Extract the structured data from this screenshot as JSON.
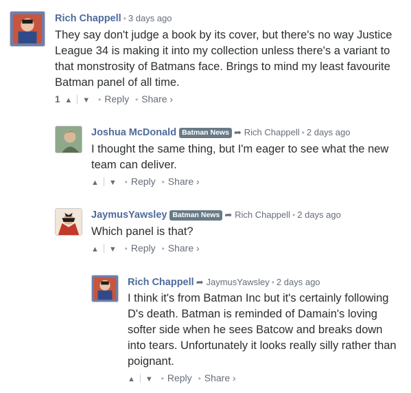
{
  "comments": [
    {
      "author": "Rich Chappell",
      "badge": "",
      "parent": "",
      "time": "3 days ago",
      "text": "They say don't judge a book by its cover, but there's no way Justice League 34 is making it into my collection unless there's a variant to that monstrosity of Batmans face. Brings to mind my least favourite Batman panel of all time.",
      "score": "1",
      "reply_label": "Reply",
      "share_label": "Share ›"
    },
    {
      "author": "Joshua McDonald",
      "badge": "Batman News",
      "parent": "Rich Chappell",
      "time": "2 days ago",
      "text": "I thought the same thing, but I'm eager to see what the new team can deliver.",
      "score": "",
      "reply_label": "Reply",
      "share_label": "Share ›"
    },
    {
      "author": "JaymusYawsley",
      "badge": "Batman News",
      "parent": "Rich Chappell",
      "time": "2 days ago",
      "text": "Which panel is that?",
      "score": "",
      "reply_label": "Reply",
      "share_label": "Share ›"
    },
    {
      "author": "Rich Chappell",
      "badge": "",
      "parent": "JaymusYawsley",
      "time": "2 days ago",
      "text": "I think it's from Batman Inc but it's certainly following D's death. Batman is reminded of Damain's loving softer side when he sees Batcow and breaks down into tears. Unfortunately it looks really silly rather than poignant.",
      "score": "",
      "reply_label": "Reply",
      "share_label": "Share ›"
    }
  ],
  "icons": {
    "upvote": "chevron-up-icon",
    "downvote": "chevron-down-icon",
    "reply_arrow": "reply-arrow-icon"
  },
  "colors": {
    "author": "#4e6b9c",
    "meta": "#656c7a",
    "badge": "#687a86",
    "text": "#2a2e2e"
  }
}
